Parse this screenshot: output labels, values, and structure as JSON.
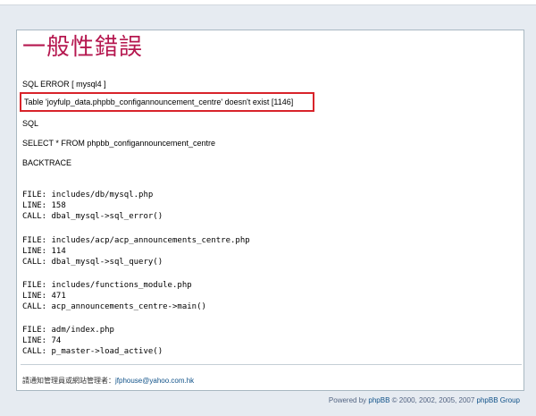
{
  "page": {
    "title": "一般性錯誤"
  },
  "error": {
    "sql_error_label": "SQL ERROR [ mysql4 ]",
    "message": "Table 'joyfulp_data.phpbb_configannouncement_centre' doesn't exist [1146]",
    "sql_label": "SQL",
    "sql_query": "SELECT * FROM phpbb_configannouncement_centre",
    "backtrace_label": "BACKTRACE"
  },
  "backtrace": [
    {
      "file_label": "FILE:",
      "file": "includes/db/mysql.php",
      "line_label": "LINE:",
      "line": "158",
      "call_label": "CALL:",
      "call": "dbal_mysql->sql_error()"
    },
    {
      "file_label": "FILE:",
      "file": "includes/acp/acp_announcements_centre.php",
      "line_label": "LINE:",
      "line": "114",
      "call_label": "CALL:",
      "call": "dbal_mysql->sql_query()"
    },
    {
      "file_label": "FILE:",
      "file": "includes/functions_module.php",
      "line_label": "LINE:",
      "line": "471",
      "call_label": "CALL:",
      "call": "acp_announcements_centre->main()"
    },
    {
      "file_label": "FILE:",
      "file": "adm/index.php",
      "line_label": "LINE:",
      "line": "74",
      "call_label": "CALL:",
      "call": "p_master->load_active()"
    }
  ],
  "contact": {
    "label": "請通知管理員或網站管理者：",
    "email": "jfphouse@yahoo.com.hk"
  },
  "footer": {
    "prefix": "Powered by ",
    "brand": "phpBB",
    "copyright": " © 2000, 2002, 2005, 2007 ",
    "group": "phpBB Group"
  },
  "colors": {
    "title": "#b5174f",
    "highlight_box": "#d8232a",
    "link": "#105289"
  }
}
